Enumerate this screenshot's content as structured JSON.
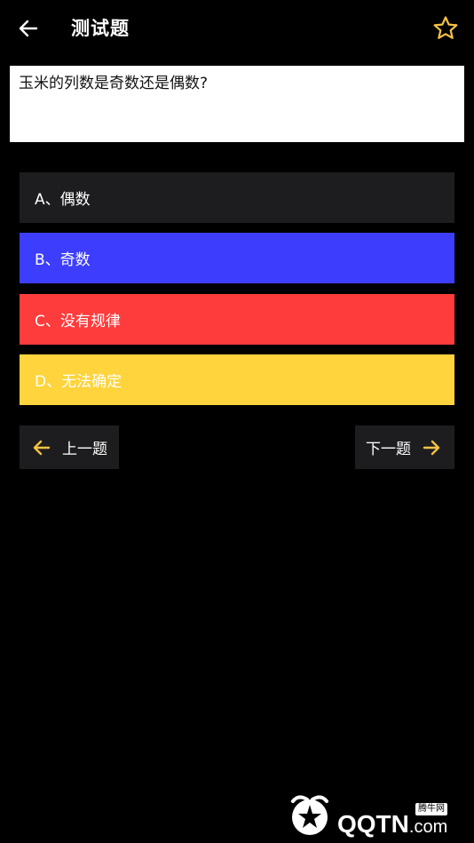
{
  "colors": {
    "background": "#000000",
    "accent": "#f5c242",
    "option_a": "#1d1d1f",
    "option_b": "#3d3dfd",
    "option_c": "#ff3c3c",
    "option_d": "#ffd43c"
  },
  "header": {
    "back_icon": "arrow-left-icon",
    "title": "测试题",
    "favorite_icon": "star-outline-icon"
  },
  "question": {
    "text": "玉米的列数是奇数还是偶数?"
  },
  "options": [
    {
      "label": "A、偶数"
    },
    {
      "label": "B、奇数"
    },
    {
      "label": "C、没有规律"
    },
    {
      "label": "D、无法确定"
    }
  ],
  "navigation": {
    "prev_label": "上一题",
    "prev_icon": "arrow-left-icon",
    "next_label": "下一题",
    "next_icon": "arrow-right-icon"
  },
  "watermark": {
    "badge": "腾牛网",
    "brand": "QQTN",
    "suffix": ".com"
  }
}
